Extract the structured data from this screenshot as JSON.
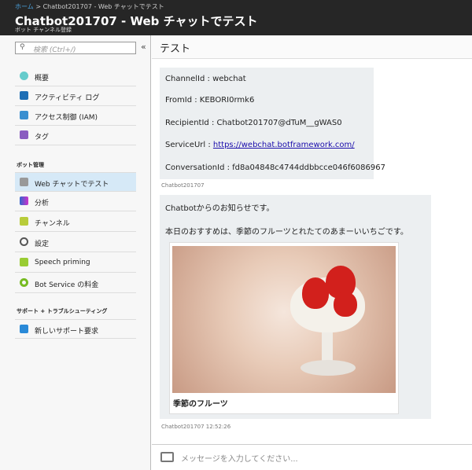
{
  "header": {
    "breadcrumb_home": "ホーム",
    "breadcrumb_sep": ">",
    "breadcrumb_current": "Chatbot201707 - Web チャットでテスト",
    "title": "Chatbot201707 - Web チャットでテスト",
    "subtitle": "ボット チャンネル登録"
  },
  "sidebar": {
    "search_placeholder": "検索 (Ctrl+/)",
    "collapse": "«",
    "items": [
      {
        "label": "概要"
      },
      {
        "label": "アクティビティ ログ"
      },
      {
        "label": "アクセス制御 (IAM)"
      },
      {
        "label": "タグ"
      }
    ],
    "section1": "ボット管理",
    "bot_items": [
      {
        "label": "Web チャットでテスト"
      },
      {
        "label": "分析"
      },
      {
        "label": "チャンネル"
      },
      {
        "label": "設定"
      },
      {
        "label": "Speech priming"
      },
      {
        "label": "Bot Service の料金"
      }
    ],
    "section2": "サポート + トラブルシューティング",
    "support_items": [
      {
        "label": "新しいサポート要求"
      }
    ]
  },
  "main": {
    "title": "テスト",
    "msg1": {
      "channel": "ChannelId : webchat",
      "from": "FromId : KEBORI0rmk6",
      "recipient": "RecipientId : Chatbot201707@dTuM__gWAS0",
      "service_label": "ServiceUrl : ",
      "service_url": "https://webchat.botframework.com/",
      "conversation": "ConversationId : fd8a04848c4744ddbbcce046f6086967",
      "sender": "Chatbot201707"
    },
    "msg2": {
      "line1": "Chatbotからのお知らせです。",
      "line2": "本日のおすすめは、季節のフルーツとれたてのあまーいいちごです。",
      "card_caption": "季節のフルーツ",
      "sender": "Chatbot201707 12:52:26"
    },
    "input_placeholder": "メッセージを入力してください..."
  }
}
